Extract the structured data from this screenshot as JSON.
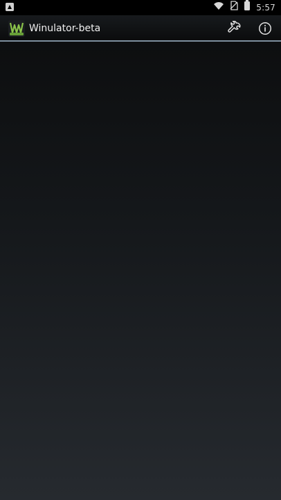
{
  "status_bar": {
    "time": "5:57",
    "icons": [
      "notification-icon",
      "wifi-icon",
      "no-sim-icon",
      "battery-icon"
    ]
  },
  "app_bar": {
    "title": "Winulator-beta",
    "logo_icon": "winulator-logo-icon",
    "actions": [
      {
        "icon": "wrench-icon"
      },
      {
        "icon": "info-icon"
      }
    ],
    "divider_color": "#7e8f9f"
  },
  "content": {
    "background_top": "#0b0c0d",
    "background_bottom": "#262a2f"
  }
}
